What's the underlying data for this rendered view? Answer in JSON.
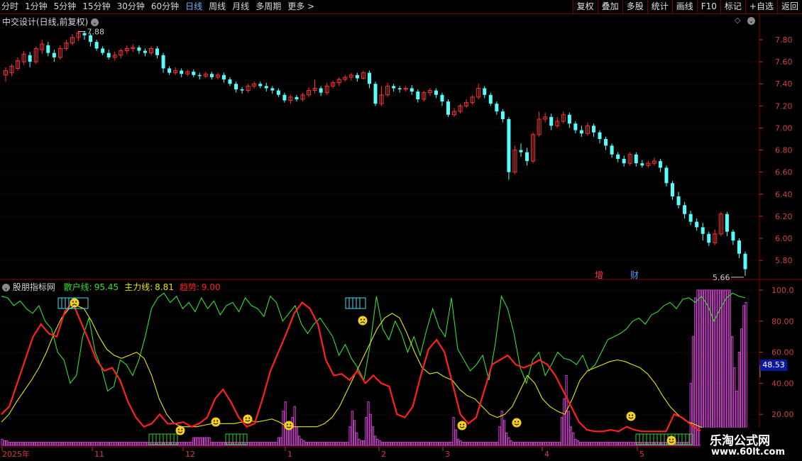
{
  "toolbar": {
    "periods": [
      "分时",
      "1分钟",
      "5分钟",
      "15分钟",
      "30分钟",
      "60分钟",
      "日线",
      "周线",
      "月线",
      "多周期",
      "更多 >"
    ],
    "active": "日线",
    "buttons": [
      "复权",
      "叠加",
      "多股",
      "统计",
      "画线",
      "F10",
      "标记",
      "+自选",
      "返回"
    ]
  },
  "main_chart": {
    "title": "中交设计(日线,前复权)",
    "high_label": "7.88",
    "low_label": "5.66",
    "y_ticks": [
      "7.80",
      "7.60",
      "7.40",
      "7.20",
      "7.00",
      "6.80",
      "6.60",
      "6.40",
      "6.20",
      "6.00",
      "5.80"
    ],
    "colors": {
      "up": "#ff3030",
      "down": "#54ffff"
    },
    "markers": [
      {
        "text": "增",
        "color": "#ff4040"
      },
      {
        "text": "财",
        "color": "#40a0ff"
      }
    ]
  },
  "indicator": {
    "name": "股朋指标网",
    "lines": [
      {
        "label": "散户线:",
        "value": "95.45",
        "color": "#30e030"
      },
      {
        "label": "主力线:",
        "value": "8.81",
        "color": "#e8e800"
      },
      {
        "label": "趋势:",
        "value": "9.00",
        "color": "#ff2020"
      }
    ],
    "y_ticks": [
      "100.0",
      "80.00",
      "60.00",
      "40.00",
      "20.00"
    ],
    "cursor_value": "48.53"
  },
  "x_axis": {
    "labels": [
      "2025年",
      "11",
      "12",
      "1",
      "2",
      "3",
      "4",
      "5"
    ]
  },
  "watermark": {
    "line1": "乐淘公式网",
    "line2": "www.60lt.com"
  },
  "chart_data": {
    "type": "candlestick",
    "title": "中交设计(日线,前复权)",
    "ylim": [
      5.64,
      7.98
    ],
    "candles": [
      [
        7.48,
        7.52,
        7.42,
        7.55
      ],
      [
        7.5,
        7.56,
        7.47,
        7.58
      ],
      [
        7.54,
        7.61,
        7.52,
        7.64
      ],
      [
        7.6,
        7.67,
        7.57,
        7.7
      ],
      [
        7.66,
        7.6,
        7.55,
        7.69
      ],
      [
        7.6,
        7.72,
        7.58,
        7.74
      ],
      [
        7.71,
        7.76,
        7.67,
        7.8
      ],
      [
        7.75,
        7.68,
        7.65,
        7.78
      ],
      [
        7.68,
        7.64,
        7.6,
        7.71
      ],
      [
        7.64,
        7.72,
        7.62,
        7.75
      ],
      [
        7.72,
        7.77,
        7.7,
        7.8
      ],
      [
        7.77,
        7.82,
        7.75,
        7.85
      ],
      [
        7.82,
        7.86,
        7.79,
        7.88
      ],
      [
        7.86,
        7.84,
        7.8,
        7.88
      ],
      [
        7.84,
        7.78,
        7.74,
        7.86
      ],
      [
        7.78,
        7.72,
        7.7,
        7.8
      ],
      [
        7.72,
        7.68,
        7.66,
        7.74
      ],
      [
        7.68,
        7.64,
        7.62,
        7.71
      ],
      [
        7.64,
        7.66,
        7.61,
        7.69
      ],
      [
        7.66,
        7.7,
        7.63,
        7.72
      ],
      [
        7.7,
        7.72,
        7.67,
        7.75
      ],
      [
        7.72,
        7.73,
        7.69,
        7.76
      ],
      [
        7.73,
        7.7,
        7.67,
        7.75
      ],
      [
        7.7,
        7.68,
        7.65,
        7.72
      ],
      [
        7.68,
        7.72,
        7.66,
        7.74
      ],
      [
        7.72,
        7.66,
        7.63,
        7.74
      ],
      [
        7.66,
        7.54,
        7.5,
        7.68
      ],
      [
        7.54,
        7.5,
        7.48,
        7.56
      ],
      [
        7.5,
        7.52,
        7.48,
        7.55
      ],
      [
        7.52,
        7.49,
        7.46,
        7.54
      ],
      [
        7.49,
        7.51,
        7.47,
        7.53
      ],
      [
        7.51,
        7.48,
        7.46,
        7.53
      ],
      [
        7.48,
        7.47,
        7.44,
        7.5
      ],
      [
        7.47,
        7.49,
        7.45,
        7.51
      ],
      [
        7.49,
        7.46,
        7.44,
        7.51
      ],
      [
        7.46,
        7.48,
        7.44,
        7.5
      ],
      [
        7.48,
        7.44,
        7.41,
        7.5
      ],
      [
        7.44,
        7.4,
        7.38,
        7.46
      ],
      [
        7.4,
        7.35,
        7.32,
        7.42
      ],
      [
        7.35,
        7.34,
        7.31,
        7.37
      ],
      [
        7.34,
        7.38,
        7.32,
        7.4
      ],
      [
        7.38,
        7.4,
        7.36,
        7.42
      ],
      [
        7.4,
        7.38,
        7.36,
        7.42
      ],
      [
        7.38,
        7.36,
        7.33,
        7.41
      ],
      [
        7.36,
        7.34,
        7.31,
        7.38
      ],
      [
        7.34,
        7.3,
        7.28,
        7.36
      ],
      [
        7.3,
        7.25,
        7.23,
        7.32
      ],
      [
        7.25,
        7.28,
        7.22,
        7.3
      ],
      [
        7.28,
        7.26,
        7.24,
        7.3
      ],
      [
        7.26,
        7.3,
        7.24,
        7.32
      ],
      [
        7.3,
        7.34,
        7.28,
        7.37
      ],
      [
        7.34,
        7.36,
        7.31,
        7.44
      ],
      [
        7.36,
        7.32,
        7.29,
        7.38
      ],
      [
        7.32,
        7.38,
        7.3,
        7.41
      ],
      [
        7.38,
        7.41,
        7.36,
        7.43
      ],
      [
        7.41,
        7.44,
        7.38,
        7.46
      ],
      [
        7.44,
        7.46,
        7.42,
        7.48
      ],
      [
        7.46,
        7.48,
        7.43,
        7.5
      ],
      [
        7.48,
        7.45,
        7.42,
        7.5
      ],
      [
        7.45,
        7.5,
        7.44,
        7.52
      ],
      [
        7.5,
        7.4,
        7.36,
        7.52
      ],
      [
        7.4,
        7.22,
        7.2,
        7.42
      ],
      [
        7.22,
        7.3,
        7.2,
        7.38
      ],
      [
        7.3,
        7.38,
        7.28,
        7.41
      ],
      [
        7.38,
        7.36,
        7.33,
        7.4
      ],
      [
        7.36,
        7.35,
        7.32,
        7.38
      ],
      [
        7.35,
        7.36,
        7.33,
        7.38
      ],
      [
        7.36,
        7.33,
        7.3,
        7.39
      ],
      [
        7.33,
        7.26,
        7.23,
        7.35
      ],
      [
        7.26,
        7.32,
        7.24,
        7.34
      ],
      [
        7.32,
        7.34,
        7.29,
        7.36
      ],
      [
        7.34,
        7.3,
        7.27,
        7.36
      ],
      [
        7.3,
        7.24,
        7.2,
        7.32
      ],
      [
        7.24,
        7.12,
        7.1,
        7.26
      ],
      [
        7.12,
        7.15,
        7.1,
        7.18
      ],
      [
        7.15,
        7.2,
        7.13,
        7.22
      ],
      [
        7.2,
        7.23,
        7.18,
        7.26
      ],
      [
        7.23,
        7.28,
        7.21,
        7.3
      ],
      [
        7.28,
        7.36,
        7.26,
        7.4
      ],
      [
        7.36,
        7.3,
        7.27,
        7.38
      ],
      [
        7.3,
        7.22,
        7.2,
        7.32
      ],
      [
        7.22,
        7.15,
        7.12,
        7.24
      ],
      [
        7.15,
        7.08,
        7.05,
        7.17
      ],
      [
        7.08,
        6.6,
        6.53,
        7.1
      ],
      [
        6.6,
        6.8,
        6.58,
        6.84
      ],
      [
        6.8,
        6.78,
        6.74,
        6.86
      ],
      [
        6.78,
        6.7,
        6.66,
        6.82
      ],
      [
        6.7,
        6.94,
        6.68,
        6.96
      ],
      [
        6.94,
        7.08,
        6.92,
        7.15
      ],
      [
        7.08,
        7.1,
        7.05,
        7.14
      ],
      [
        7.1,
        7.02,
        6.98,
        7.13
      ],
      [
        7.02,
        7.06,
        7.0,
        7.1
      ],
      [
        7.06,
        7.12,
        7.04,
        7.15
      ],
      [
        7.12,
        7.04,
        7.0,
        7.14
      ],
      [
        7.04,
        6.98,
        6.95,
        7.06
      ],
      [
        6.98,
        6.95,
        6.92,
        7.02
      ],
      [
        6.95,
        7.02,
        6.93,
        7.05
      ],
      [
        7.02,
        6.96,
        6.92,
        7.04
      ],
      [
        6.96,
        6.9,
        6.86,
        6.98
      ],
      [
        6.9,
        6.84,
        6.8,
        6.92
      ],
      [
        6.84,
        6.76,
        6.73,
        6.86
      ],
      [
        6.76,
        6.72,
        6.69,
        6.78
      ],
      [
        6.72,
        6.68,
        6.65,
        6.75
      ],
      [
        6.68,
        6.76,
        6.66,
        6.78
      ],
      [
        6.76,
        6.68,
        6.65,
        6.78
      ],
      [
        6.68,
        6.66,
        6.64,
        6.71
      ],
      [
        6.66,
        6.68,
        6.64,
        6.7
      ],
      [
        6.68,
        6.7,
        6.66,
        6.73
      ],
      [
        6.7,
        6.64,
        6.6,
        6.72
      ],
      [
        6.64,
        6.5,
        6.47,
        6.66
      ],
      [
        6.5,
        6.38,
        6.35,
        6.52
      ],
      [
        6.38,
        6.3,
        6.27,
        6.42
      ],
      [
        6.3,
        6.22,
        6.18,
        6.33
      ],
      [
        6.22,
        6.15,
        6.12,
        6.25
      ],
      [
        6.15,
        6.1,
        6.07,
        6.18
      ],
      [
        6.1,
        6.04,
        5.98,
        6.14
      ],
      [
        6.04,
        5.96,
        5.93,
        6.06
      ],
      [
        5.96,
        6.04,
        5.94,
        6.08
      ],
      [
        6.04,
        6.22,
        6.02,
        6.24
      ],
      [
        6.22,
        6.06,
        6.02,
        6.24
      ],
      [
        6.06,
        5.98,
        5.94,
        6.08
      ],
      [
        5.98,
        5.86,
        5.82,
        6.0
      ],
      [
        5.86,
        5.72,
        5.66,
        5.88
      ]
    ],
    "indicator_ylim": [
      0,
      105
    ],
    "series": [
      {
        "name": "散户线",
        "values": [
          96,
          95,
          90,
          93,
          88,
          85,
          90,
          80,
          75,
          60,
          55,
          40,
          45,
          70,
          82,
          60,
          50,
          35,
          38,
          55,
          52,
          45,
          55,
          70,
          88,
          95,
          98,
          92,
          96,
          88,
          92,
          86,
          95,
          88,
          93,
          84,
          90,
          92,
          86,
          95,
          90,
          88,
          83,
          96,
          92,
          80,
          85,
          90,
          78,
          72,
          78,
          82,
          76,
          70,
          58,
          65,
          56,
          50,
          42,
          65,
          96,
          75,
          68,
          80,
          72,
          60,
          70,
          58,
          74,
          88,
          76,
          70,
          95,
          62,
          55,
          48,
          52,
          58,
          42,
          65,
          96,
          88,
          72,
          50,
          40,
          55,
          60,
          45,
          52,
          60,
          56,
          55,
          52,
          58,
          48,
          52,
          60,
          68,
          70,
          72,
          75,
          80,
          82,
          78,
          84,
          86,
          90,
          92,
          88,
          94,
          95,
          92,
          96,
          90,
          80,
          88,
          95,
          98,
          96,
          95
        ],
        "color": "#30e030"
      },
      {
        "name": "主力线",
        "values": [
          15,
          20,
          28,
          35,
          42,
          50,
          60,
          72,
          82,
          88,
          90,
          88,
          80,
          70,
          62,
          58,
          56,
          58,
          60,
          56,
          45,
          30,
          20,
          14,
          12,
          12,
          12,
          13,
          14,
          14,
          14,
          14,
          15,
          16,
          15,
          16,
          17,
          15,
          12,
          12,
          12,
          12,
          12,
          14,
          18,
          25,
          35,
          45,
          55,
          65,
          75,
          82,
          85,
          82,
          72,
          60,
          50,
          46,
          47,
          44,
          42,
          36,
          32,
          30,
          25,
          20,
          18,
          20,
          25,
          35,
          45,
          40,
          30,
          25,
          22,
          20,
          30,
          42,
          48,
          50,
          52,
          54,
          55,
          54,
          52,
          50,
          46,
          40,
          32,
          25,
          20,
          16,
          14,
          12,
          10,
          9,
          9,
          9,
          9,
          9
        ],
        "color": "#e8e800"
      },
      {
        "name": "趋势",
        "values": [
          20,
          25,
          40,
          55,
          70,
          78,
          72,
          70,
          86,
          92,
          80,
          68,
          55,
          48,
          50,
          42,
          28,
          18,
          12,
          14,
          20,
          14,
          14,
          15,
          12,
          14,
          18,
          30,
          36,
          28,
          18,
          12,
          14,
          30,
          48,
          60,
          72,
          85,
          92,
          88,
          78,
          55,
          45,
          46,
          42,
          48,
          40,
          45,
          40,
          38,
          20,
          18,
          25,
          45,
          62,
          68,
          60,
          40,
          20,
          14,
          18,
          35,
          52,
          55,
          58,
          52,
          50,
          52,
          55,
          52,
          45,
          35,
          25,
          15,
          10,
          9,
          9,
          10,
          9,
          12,
          10,
          9,
          9,
          9,
          9,
          20,
          18,
          14,
          10,
          9,
          9,
          9,
          9,
          9,
          9
        ],
        "color": "#ff2020"
      }
    ],
    "bars": [
      4,
      3,
      3,
      2,
      2,
      2,
      2,
      2,
      2,
      2,
      2,
      2,
      2,
      2,
      2,
      2,
      2,
      2,
      2,
      2,
      2,
      2,
      2,
      2,
      2,
      2,
      2,
      2,
      2,
      2,
      2,
      2,
      2,
      2,
      2,
      2,
      2,
      2,
      2,
      2,
      2,
      2,
      2,
      2,
      2,
      2,
      2,
      2,
      2,
      2,
      2,
      2,
      2,
      2,
      2,
      2,
      2,
      2,
      2,
      2,
      2,
      2,
      2,
      2,
      2,
      2,
      2,
      2,
      2,
      2,
      2,
      2,
      2,
      2,
      2,
      2,
      2,
      2,
      2,
      2,
      2,
      2,
      2,
      5,
      5,
      5,
      5,
      5,
      5,
      5,
      5,
      2,
      2,
      2,
      2,
      2,
      2,
      2,
      2,
      2,
      2,
      2,
      2,
      2,
      2,
      2,
      2,
      2,
      2,
      2,
      2,
      2,
      2,
      2,
      2,
      2,
      2,
      2,
      2,
      2,
      5,
      5,
      22,
      28,
      14,
      10,
      18,
      25,
      12,
      6,
      4,
      3,
      2,
      2,
      2,
      2,
      2,
      2,
      2,
      2,
      2,
      2,
      2,
      2,
      2,
      2,
      2,
      2,
      2,
      2,
      2,
      12,
      22,
      16,
      8,
      4,
      3,
      3,
      18,
      28,
      20,
      12,
      6,
      4,
      3,
      2,
      2,
      2,
      2,
      2,
      2,
      2,
      2,
      2,
      2,
      2,
      2,
      2,
      2,
      2,
      2,
      2,
      2,
      2,
      2,
      2,
      2,
      2,
      2,
      2,
      2,
      2,
      2,
      2,
      2,
      2,
      18,
      10,
      4,
      3,
      2,
      2,
      2,
      2,
      2,
      2,
      2,
      2,
      2,
      2,
      2,
      2,
      2,
      2,
      2,
      2,
      12,
      22,
      16,
      8,
      5,
      3,
      2,
      2,
      2,
      2,
      2,
      2,
      2,
      2,
      2,
      2,
      2,
      2,
      2,
      2,
      2,
      2,
      2,
      2,
      2,
      2,
      2,
      18,
      30,
      45,
      22,
      12,
      8,
      4,
      3,
      2,
      2,
      2,
      2,
      2,
      2,
      2,
      2,
      2,
      2,
      2,
      2,
      2,
      2,
      2,
      2,
      2,
      2,
      2,
      2,
      2,
      2,
      2,
      2,
      2,
      2,
      2,
      2,
      2,
      2,
      2,
      2,
      2,
      2,
      2,
      2,
      2,
      2,
      2,
      2,
      2,
      2,
      2,
      2,
      2,
      2,
      2,
      2,
      40,
      70,
      95,
      100,
      100,
      100,
      100,
      100,
      100,
      100,
      100,
      100,
      100,
      100,
      100,
      100,
      100,
      100,
      70,
      50,
      35,
      60,
      75,
      90,
      92
    ]
  }
}
